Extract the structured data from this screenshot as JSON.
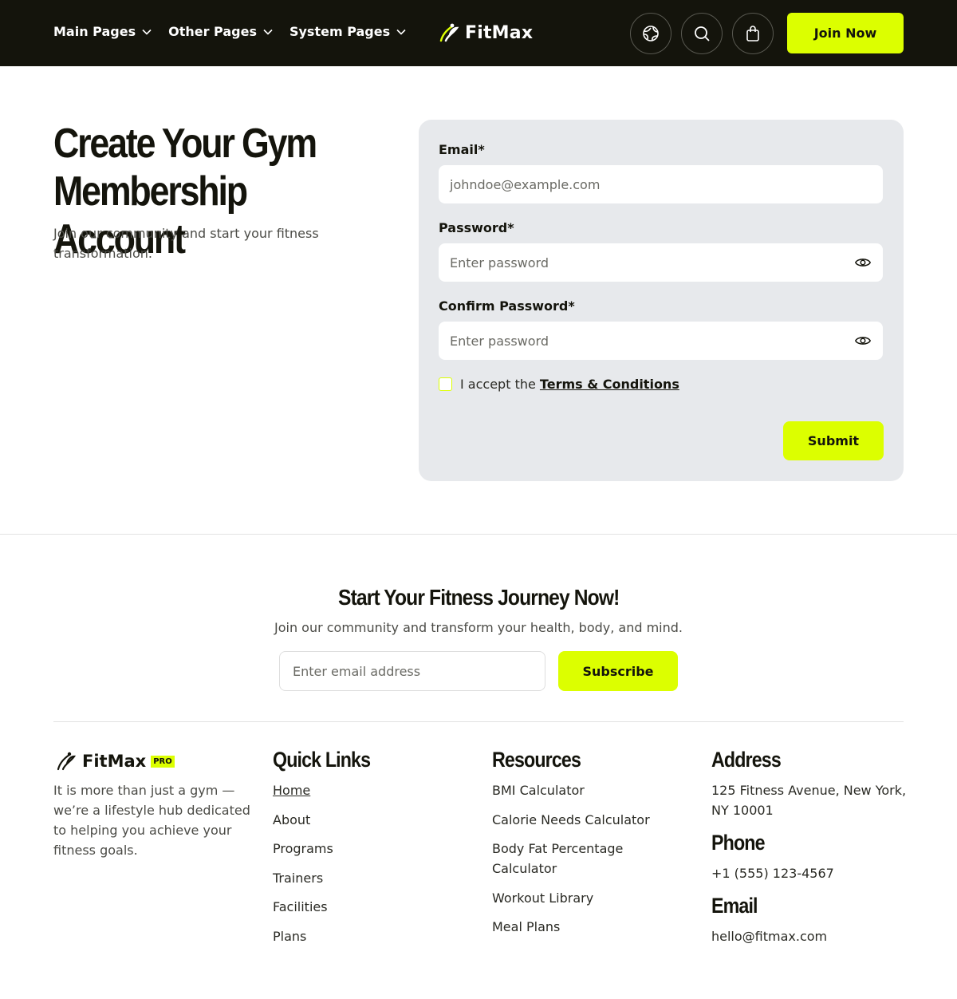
{
  "nav": {
    "menu": [
      "Main Pages",
      "Other Pages",
      "System Pages"
    ],
    "logo": "FitMax",
    "icons": [
      "globe-icon",
      "search-icon",
      "shopping-bag-icon"
    ],
    "cta": "Join Now"
  },
  "hero": {
    "title_line1": "Create Your Gym",
    "title_line2": "Membership Account",
    "subtitle": "Join our community and start your fitness transformation."
  },
  "form": {
    "email_label": "Email*",
    "email_placeholder": "johndoe@example.com",
    "password_label": "Password*",
    "password_placeholder": "Enter password",
    "confirm_label": "Confirm Password*",
    "confirm_placeholder": "Enter password",
    "accept_text": "I accept the",
    "terms_link": "Terms & Conditions",
    "submit": "Submit"
  },
  "newsletter": {
    "title": "Start Your Fitness Journey Now!",
    "subtitle": "Join our community and transform your health, body, and mind.",
    "placeholder": "Enter email address",
    "button": "Subscribe"
  },
  "footer": {
    "logo": "FitMax",
    "badge": "PRO",
    "about": "It is more than just a gym — we’re a lifestyle hub dedicated to helping you achieve your fitness goals.",
    "quick_links_title": "Quick Links",
    "quick_links": [
      "Home",
      "About",
      "Programs",
      "Trainers",
      "Facilities",
      "Plans"
    ],
    "resources_title": "Resources",
    "resources": [
      "BMI Calculator",
      "Calorie Needs Calculator",
      "Body Fat Percentage Calculator",
      "Workout Library",
      "Meal Plans"
    ],
    "address_title": "Address",
    "address": "125 Fitness Avenue, New York, NY 10001",
    "phone_title": "Phone",
    "phone": "+1 (555) 123-4567",
    "email_title": "Email",
    "email": "hello@fitmax.com"
  },
  "colors": {
    "accent": "#dcff00",
    "nav_bg": "#14140c",
    "card_bg": "#e7e9ec"
  }
}
